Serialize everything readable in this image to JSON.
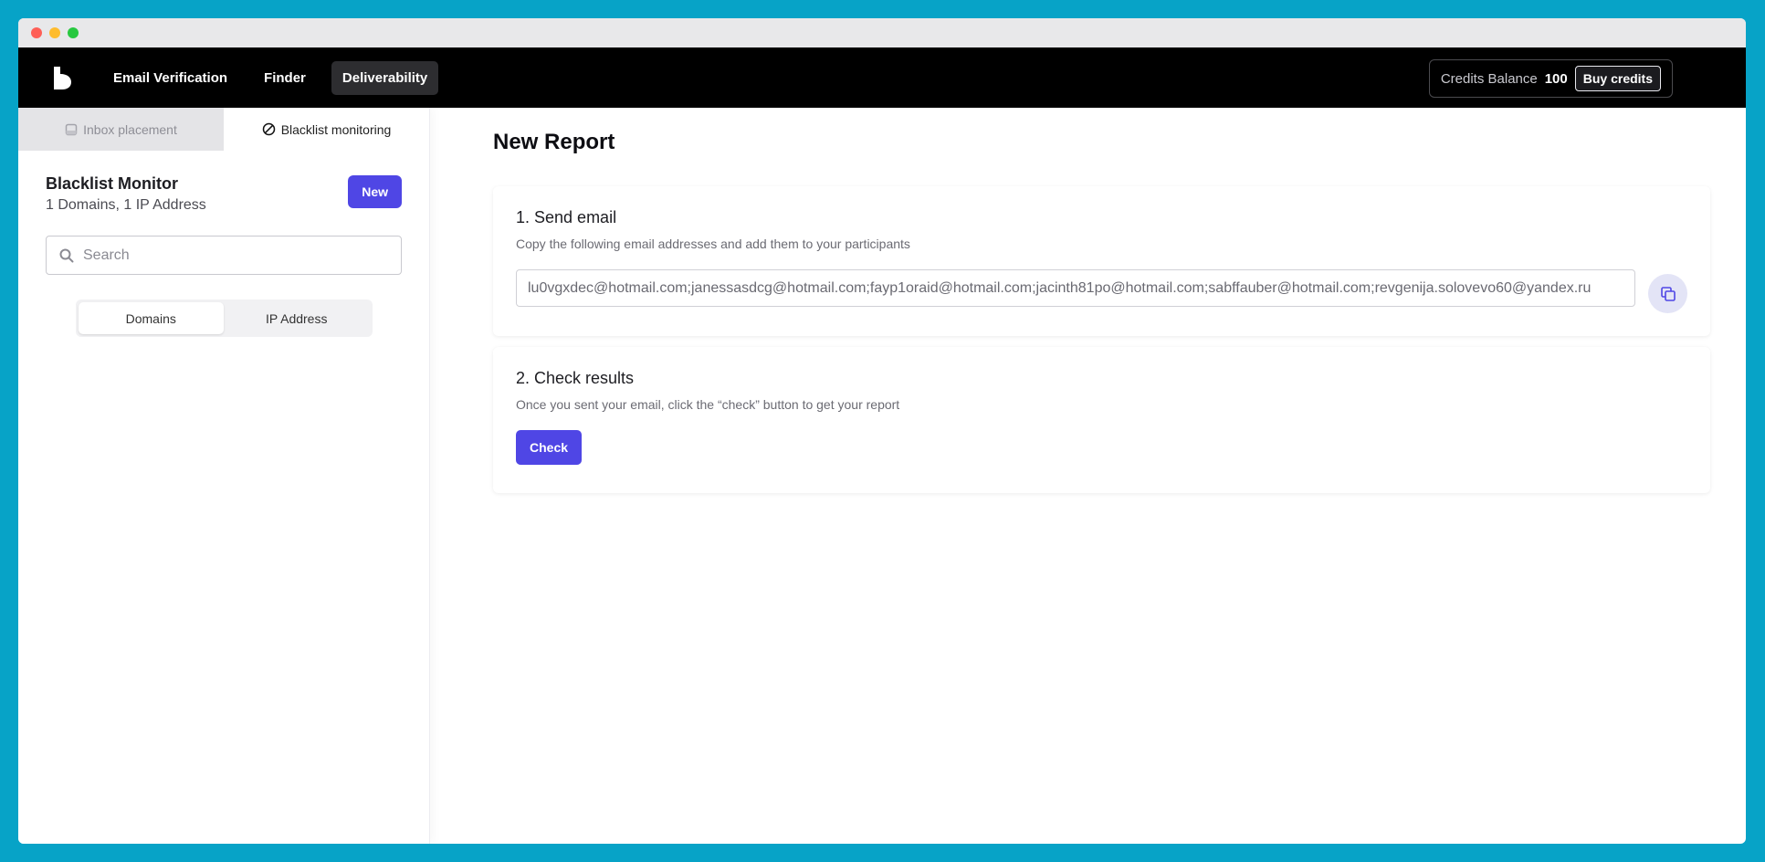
{
  "colors": {
    "accent": "#4f46e5",
    "background": "#07a3c7",
    "topbar": "#000000"
  },
  "nav": {
    "items": [
      {
        "label": "Email Verification"
      },
      {
        "label": "Finder"
      },
      {
        "label": "Deliverability"
      }
    ],
    "credits_label": "Credits Balance",
    "credits_value": "100",
    "buy_label": "Buy credits"
  },
  "sidebar": {
    "tabs": [
      {
        "label": "Inbox placement",
        "icon": "inbox-icon"
      },
      {
        "label": "Blacklist monitoring",
        "icon": "ban-icon"
      }
    ],
    "title": "Blacklist Monitor",
    "subtitle": "1 Domains, 1 IP Address",
    "new_label": "New",
    "search_placeholder": "Search",
    "segments": [
      "Domains",
      "IP Address"
    ]
  },
  "main": {
    "title": "New Report",
    "step1": {
      "title": "1. Send email",
      "subtitle": "Copy the following email addresses and add them to your participants",
      "emails": "lu0vgxdec@hotmail.com;janessasdcg@hotmail.com;fayp1oraid@hotmail.com;jacinth81po@hotmail.com;sabffauber@hotmail.com;revgenija.solovevo60@yandex.ru"
    },
    "step2": {
      "title": "2. Check results",
      "subtitle": "Once you sent your email, click the “check” button to get your report",
      "check_label": "Check"
    }
  }
}
